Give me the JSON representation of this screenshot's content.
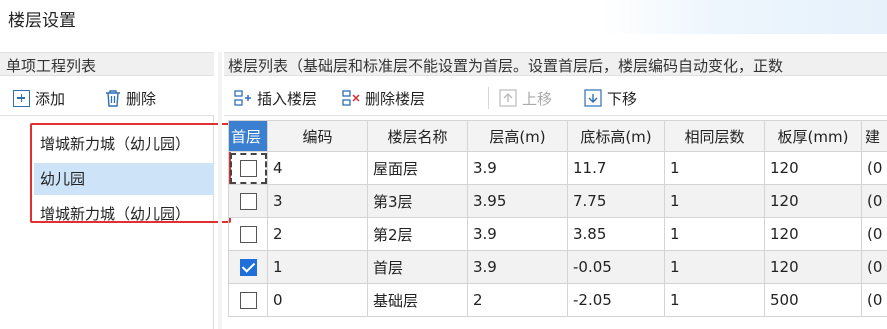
{
  "window": {
    "title": "楼层设置"
  },
  "left_panel": {
    "header": "单项工程列表",
    "toolbar": {
      "add_label": "添加",
      "delete_label": "删除"
    },
    "items": [
      {
        "label": "增城新力城（幼儿园）",
        "selected": false
      },
      {
        "label": "幼儿园",
        "selected": true
      },
      {
        "label": "增城新力城（幼儿园）",
        "selected": false
      }
    ]
  },
  "right_panel": {
    "header": "楼层列表（基础层和标准层不能设置为首层。设置首层后，楼层编码自动变化，正数",
    "toolbar": {
      "insert_label": "插入楼层",
      "delete_label": "删除楼层",
      "move_up_label": "上移",
      "move_down_label": "下移"
    },
    "columns": [
      "首层",
      "编码",
      "楼层名称",
      "层高(m)",
      "底标高(m)",
      "相同层数",
      "板厚(mm)",
      "建"
    ],
    "rows": [
      {
        "first": false,
        "code": "4",
        "name": "屋面层",
        "height": "3.9",
        "base": "11.7",
        "same": "1",
        "slab": "120",
        "extra": "(0"
      },
      {
        "first": false,
        "code": "3",
        "name": "第3层",
        "height": "3.95",
        "base": "7.75",
        "same": "1",
        "slab": "120",
        "extra": "(0"
      },
      {
        "first": false,
        "code": "2",
        "name": "第2层",
        "height": "3.9",
        "base": "3.85",
        "same": "1",
        "slab": "120",
        "extra": "(0"
      },
      {
        "first": true,
        "code": "1",
        "name": "首层",
        "height": "3.9",
        "base": "-0.05",
        "same": "1",
        "slab": "120",
        "extra": "(0"
      },
      {
        "first": false,
        "code": "0",
        "name": "基础层",
        "height": "2",
        "base": "-2.05",
        "same": "1",
        "slab": "500",
        "extra": "(0"
      }
    ]
  },
  "colors": {
    "accent": "#3a7fd0",
    "selection": "#cde3f7",
    "highlight_border": "#e03030",
    "check": "#1e6fd9"
  },
  "icons": [
    "add-icon",
    "trash-icon",
    "insert-floor-icon",
    "delete-floor-icon",
    "move-up-icon",
    "move-down-icon",
    "checkbox-icon"
  ]
}
